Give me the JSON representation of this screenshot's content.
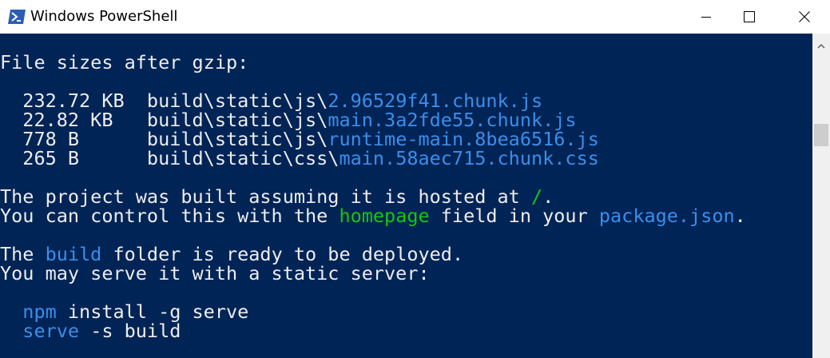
{
  "window": {
    "title": "Windows PowerShell"
  },
  "colors": {
    "background": "#012456",
    "foreground": "#ededed",
    "accent_blue": "#3b8eea",
    "accent_green": "#16c60c"
  },
  "terminal": {
    "lines": [
      [
        {
          "t": "File sizes after gzip:"
        }
      ],
      [],
      [
        {
          "t": "  232.72 KB  build\\static\\js\\"
        },
        {
          "t": "2.96529f41.chunk.js",
          "c": "blue"
        }
      ],
      [
        {
          "t": "  22.82 KB   build\\static\\js\\"
        },
        {
          "t": "main.3a2fde55.chunk.js",
          "c": "blue"
        }
      ],
      [
        {
          "t": "  778 B      build\\static\\js\\"
        },
        {
          "t": "runtime-main.8bea6516.js",
          "c": "blue"
        }
      ],
      [
        {
          "t": "  265 B      build\\static\\css\\"
        },
        {
          "t": "main.58aec715.chunk.css",
          "c": "blue"
        }
      ],
      [],
      [
        {
          "t": "The project was built assuming it is hosted at "
        },
        {
          "t": "/",
          "c": "green"
        },
        {
          "t": "."
        }
      ],
      [
        {
          "t": "You can control this with the "
        },
        {
          "t": "homepage",
          "c": "green"
        },
        {
          "t": " field in your "
        },
        {
          "t": "package.json",
          "c": "blue"
        },
        {
          "t": "."
        }
      ],
      [],
      [
        {
          "t": "The "
        },
        {
          "t": "build",
          "c": "blue"
        },
        {
          "t": " folder is ready to be deployed."
        }
      ],
      [
        {
          "t": "You may serve it with a static server:"
        }
      ],
      [],
      [
        {
          "t": "  "
        },
        {
          "t": "npm",
          "c": "blue"
        },
        {
          "t": " install -g serve"
        }
      ],
      [
        {
          "t": "  "
        },
        {
          "t": "serve",
          "c": "blue"
        },
        {
          "t": " -s build"
        }
      ]
    ]
  }
}
